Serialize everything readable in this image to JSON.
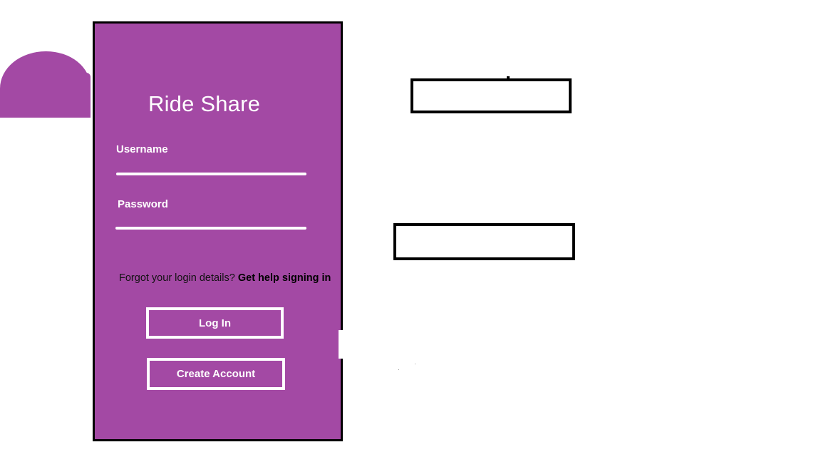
{
  "app": {
    "title": "Ride Share"
  },
  "login_form": {
    "username_label": "Username",
    "username_value": "",
    "password_label": "Password",
    "password_value": "",
    "forgot_text": "Forgot your login details?",
    "help_link": "Get help signing in",
    "login_button": "Log In",
    "create_account_button": "Create Account"
  },
  "colors": {
    "brand": "#a349a4",
    "text_light": "#ffffff",
    "border": "#000000"
  }
}
